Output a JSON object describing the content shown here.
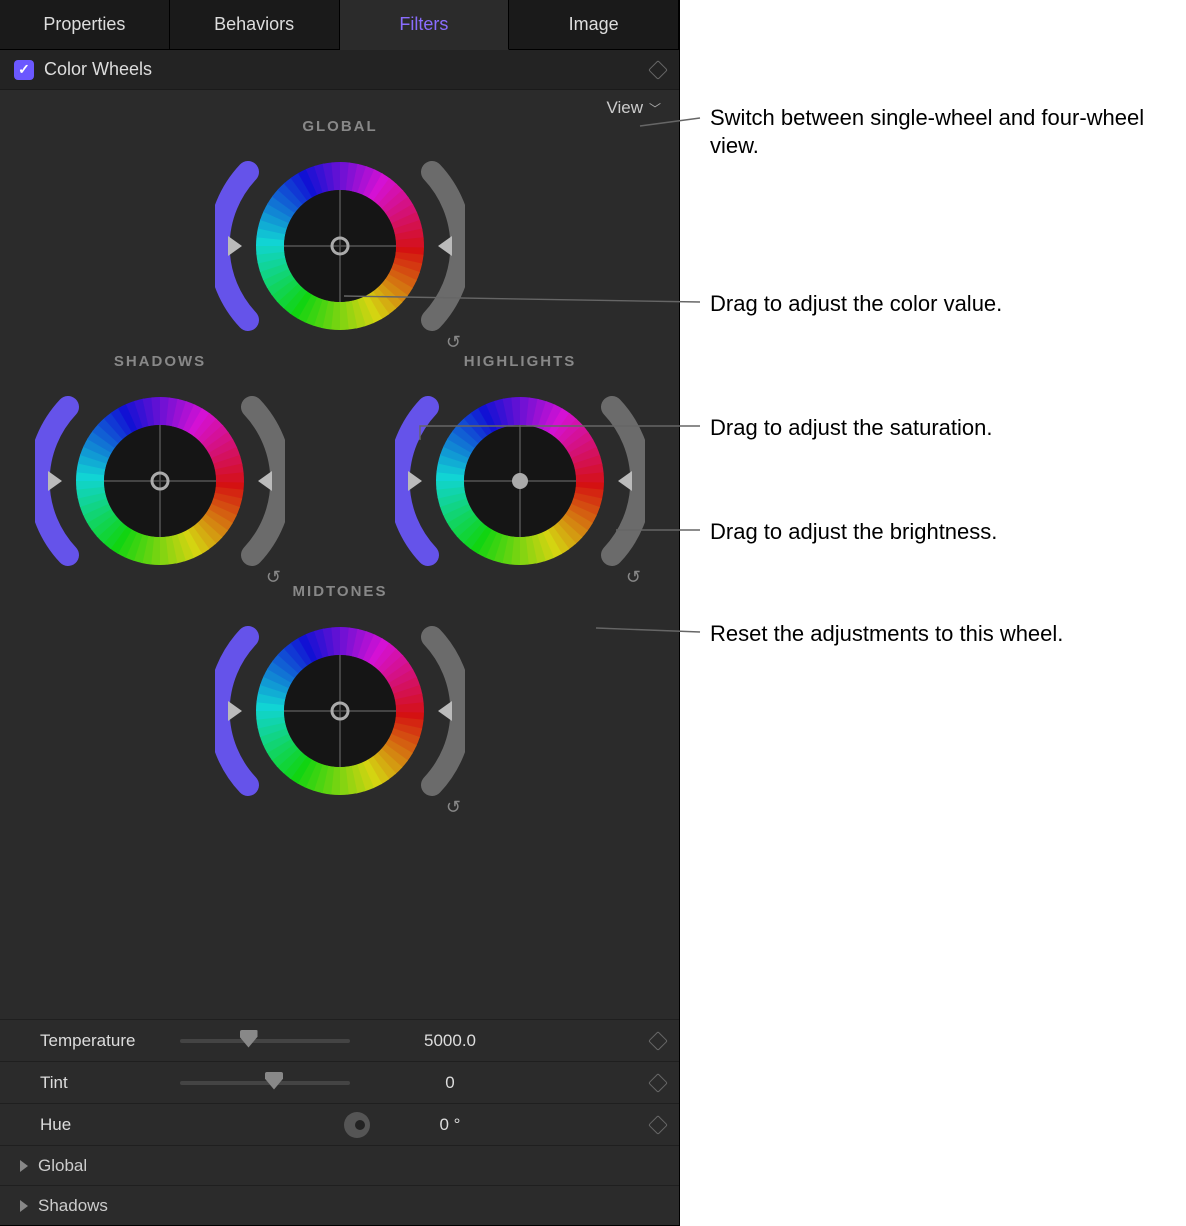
{
  "tabs": {
    "properties": "Properties",
    "behaviors": "Behaviors",
    "filters": "Filters",
    "image": "Image",
    "active": "filters"
  },
  "section": {
    "title": "Color Wheels",
    "enabled": true
  },
  "view_menu": {
    "label": "View"
  },
  "wheels": {
    "global": "GLOBAL",
    "shadows": "SHADOWS",
    "highlights": "HIGHLIGHTS",
    "midtones": "MIDTONES"
  },
  "params": {
    "temperature": {
      "label": "Temperature",
      "value": "5000.0",
      "pos": 35
    },
    "tint": {
      "label": "Tint",
      "value": "0",
      "pos": 50
    },
    "hue": {
      "label": "Hue",
      "value": "0 °"
    }
  },
  "disclosures": {
    "global": "Global",
    "shadows": "Shadows"
  },
  "callouts": {
    "view": "Switch between single-wheel and four-wheel view.",
    "color": "Drag to adjust the color value.",
    "sat": "Drag to adjust the saturation.",
    "bright": "Drag to adjust the brightness.",
    "reset": "Reset the adjustments to this wheel."
  }
}
